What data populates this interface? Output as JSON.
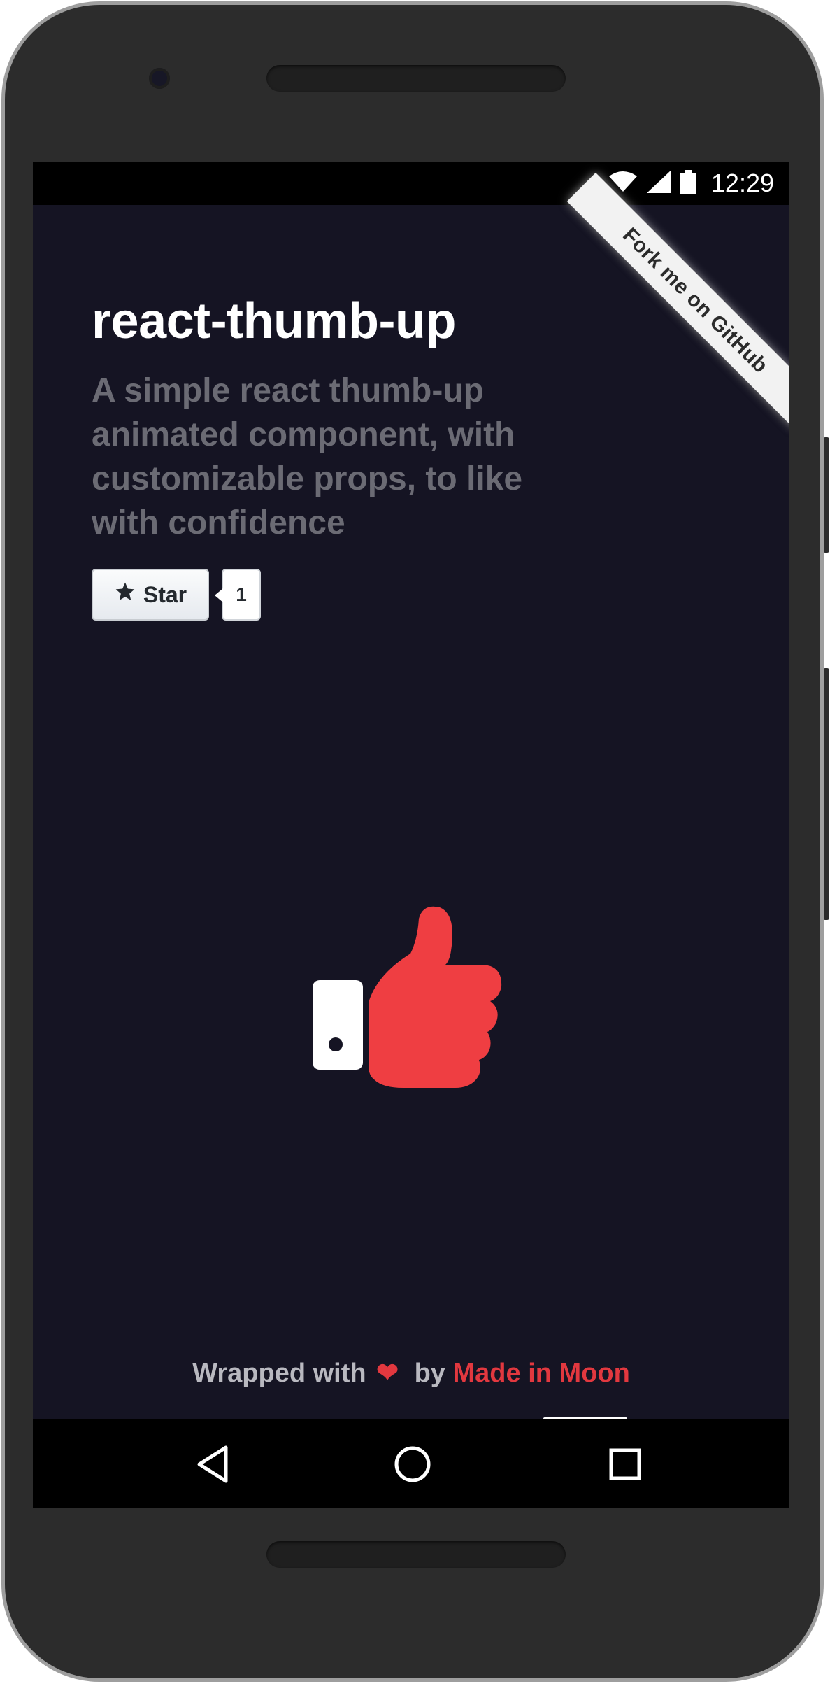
{
  "status_bar": {
    "time": "12:29",
    "icons": [
      "wifi-icon",
      "cell-signal-icon",
      "battery-icon"
    ]
  },
  "ribbon": {
    "label": "Fork me on GitHub"
  },
  "header": {
    "title": "react-thumb-up",
    "subtitle": "A simple react thumb-up animated component, with customizable props, to like with confidence"
  },
  "github_star": {
    "label": "Star",
    "count": "1",
    "icon": "star-icon"
  },
  "thumb": {
    "icon": "thumb-up-icon",
    "color": "#ef3e42"
  },
  "footer": {
    "prefix": "Wrapped with",
    "heart": "❤",
    "by": "by",
    "link": "Made in Moon"
  },
  "nav_bar": {
    "icons": [
      "back-icon",
      "home-icon",
      "recent-apps-icon"
    ]
  },
  "colors": {
    "background": "#151423",
    "accent": "#e2383f",
    "subtitle": "#6b6b74"
  }
}
